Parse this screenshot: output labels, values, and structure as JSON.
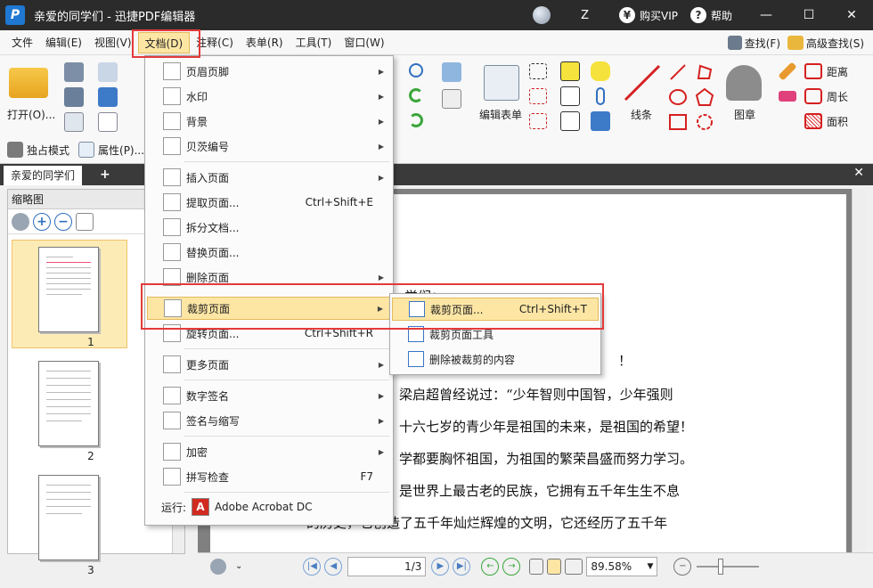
{
  "window": {
    "title": "亲爱的同学们 - 迅捷PDF编辑器",
    "logo": "P",
    "user": "Z",
    "vip_label": "购买VIP",
    "vip_symbol": "¥",
    "help_label": "帮助",
    "help_symbol": "?",
    "minimize": "—",
    "maximize": "☐",
    "close": "✕"
  },
  "menubar": {
    "items": [
      "文件",
      "编辑(E)",
      "视图(V)",
      "文档(D)",
      "注释(C)",
      "表单(R)",
      "工具(T)",
      "窗口(W)"
    ],
    "find": "查找(F)",
    "advanced_find": "高级查找(S)"
  },
  "ribbon": {
    "open": "打开(O)...",
    "exclusive_mode": "独占模式",
    "properties": "属性(P)...",
    "edit_form": "编辑表单",
    "line": "线条",
    "stamp": "图章",
    "distance": "距离",
    "perimeter": "周长",
    "area": "面积"
  },
  "tabs": {
    "doc_tab": "亲爱的同学们",
    "add": "+",
    "close": "✕"
  },
  "left_panel": {
    "title": "缩略图",
    "pages": [
      "1",
      "2",
      "3"
    ]
  },
  "document": {
    "lines": [
      "学们：",
      "！",
      "梁启超曾经说过：“少年智则中国智，少年强则",
      "十六七岁的青少年是祖国的未来，是祖国的希望！",
      "学都要胸怀祖国，为祖国的繁荣昌盛而努力学习。",
      "是世界上最古老的民族，它拥有五千年生生不息",
      "的历史，它创造了五千年灿烂辉煌的文明，它还经历了五千年"
    ]
  },
  "statusbar": {
    "page": "1",
    "page_total": "/3",
    "zoom": "89.58%"
  },
  "dropdown": {
    "items": [
      {
        "label": "页眉页脚",
        "shortcut": "",
        "arrow": "▶"
      },
      {
        "label": "水印",
        "shortcut": "",
        "arrow": "▶"
      },
      {
        "label": "背景",
        "shortcut": "",
        "arrow": "▶"
      },
      {
        "label": "贝茨编号",
        "shortcut": "",
        "arrow": "▶"
      },
      {
        "label": "插入页面",
        "shortcut": "",
        "arrow": "▶"
      },
      {
        "label": "提取页面...",
        "shortcut": "Ctrl+Shift+E",
        "arrow": ""
      },
      {
        "label": "拆分文档...",
        "shortcut": "",
        "arrow": ""
      },
      {
        "label": "替换页面...",
        "shortcut": "",
        "arrow": ""
      },
      {
        "label": "删除页面",
        "shortcut": "",
        "arrow": "▶"
      },
      {
        "label": "裁剪页面",
        "shortcut": "",
        "arrow": "▶"
      },
      {
        "label": "旋转页面...",
        "shortcut": "Ctrl+Shift+R",
        "arrow": ""
      },
      {
        "label": "更多页面",
        "shortcut": "",
        "arrow": "▶"
      },
      {
        "label": "数字签名",
        "shortcut": "",
        "arrow": "▶"
      },
      {
        "label": "签名与缩写",
        "shortcut": "",
        "arrow": "▶"
      },
      {
        "label": "加密",
        "shortcut": "",
        "arrow": "▶"
      },
      {
        "label": "拼写检查",
        "shortcut": "F7",
        "arrow": ""
      }
    ],
    "run_label": "运行:",
    "run_app": "Adobe Acrobat DC"
  },
  "submenu": {
    "items": [
      {
        "label": "裁剪页面...",
        "shortcut": "Ctrl+Shift+T"
      },
      {
        "label": "裁剪页面工具",
        "shortcut": ""
      },
      {
        "label": "删除被裁剪的内容",
        "shortcut": ""
      }
    ]
  }
}
